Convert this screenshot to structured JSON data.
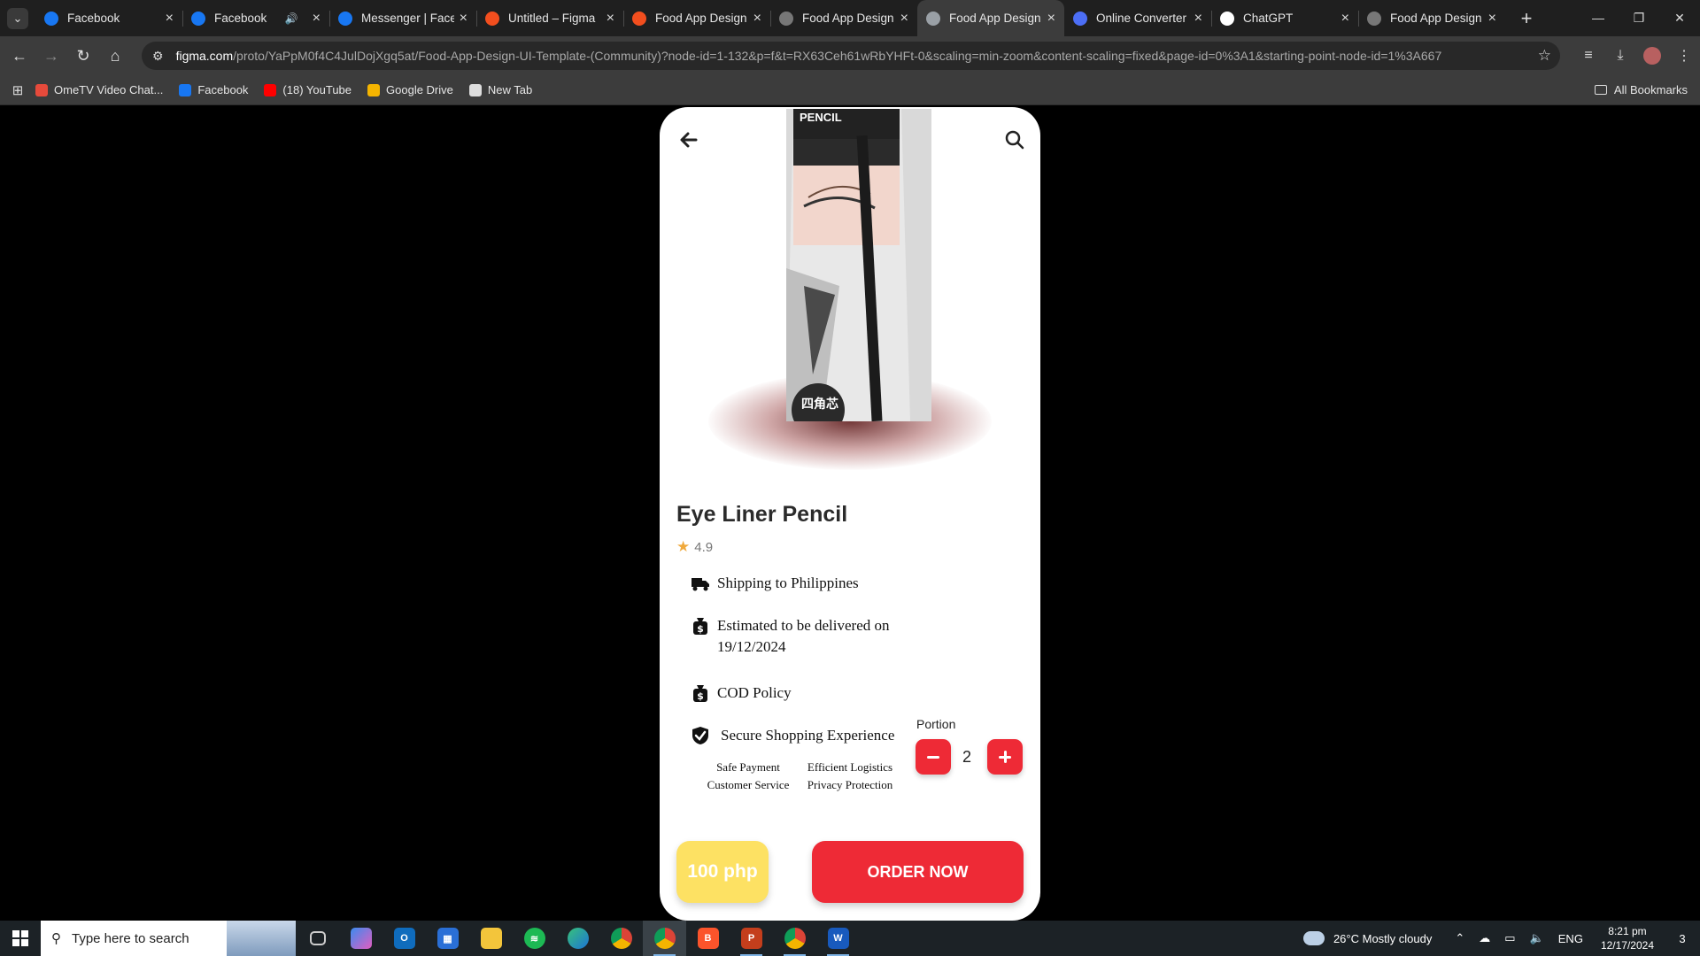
{
  "browser": {
    "tabs": [
      {
        "title": "Facebook",
        "favicon": "facebook-icon",
        "color": "#1877f2"
      },
      {
        "title": "Facebook",
        "favicon": "facebook-icon",
        "color": "#1877f2",
        "audio": true
      },
      {
        "title": "Messenger | Faceb",
        "favicon": "facebook-icon",
        "color": "#1877f2"
      },
      {
        "title": "Untitled – Figma",
        "favicon": "figma-icon",
        "color": "#f24e1e"
      },
      {
        "title": "Food App Design",
        "favicon": "figma-icon",
        "color": "#f24e1e"
      },
      {
        "title": "Food App Design",
        "favicon": "globe-icon",
        "color": "#777777"
      },
      {
        "title": "Food App Design",
        "favicon": "play-icon",
        "color": "#9aa0a6",
        "active": true
      },
      {
        "title": "Online Converter",
        "favicon": "converter-icon",
        "color": "#4c6ef5"
      },
      {
        "title": "ChatGPT",
        "favicon": "chatgpt-icon",
        "color": "#ffffff"
      },
      {
        "title": "Food App Design",
        "favicon": "globe-icon",
        "color": "#777777"
      }
    ],
    "url_host": "figma.com",
    "url_path": "/proto/YaPpM0f4C4JulDojXgq5at/Food-App-Design-UI-Template-(Community)?node-id=1-132&p=f&t=RX63Ceh61wRbYHFt-0&scaling=min-zoom&content-scaling=fixed&page-id=0%3A1&starting-point-node-id=1%3A667",
    "bookmarks": [
      {
        "label": "OmeTV Video Chat...",
        "icon": "ometv-icon",
        "color": "#e64a3b"
      },
      {
        "label": "Facebook",
        "icon": "facebook-icon",
        "color": "#1877f2"
      },
      {
        "label": "(18) YouTube",
        "icon": "youtube-icon",
        "color": "#ff0000"
      },
      {
        "label": "Google Drive",
        "icon": "google-drive-icon",
        "color": "#f4b400"
      },
      {
        "label": "New Tab",
        "icon": "globe-icon",
        "color": "#dddddd"
      }
    ],
    "all_bookmarks": "All Bookmarks"
  },
  "product": {
    "image_label": "PENCIL",
    "image_brand": "EYELINER PENCIL",
    "title": "Eye Liner Pencil",
    "rating": "4.9",
    "shipping": "Shipping to Philippines",
    "estimate": "Estimated to be delivered on 19/12/2024",
    "cod": "COD Policy",
    "secure": "Secure Shopping Experience",
    "features": [
      "Safe Payment",
      "Efficient Logistics",
      "Customer Service",
      "Privacy Protection"
    ],
    "portion_label": "Portion",
    "quantity": "2",
    "price": "100 php",
    "order_label": "ORDER NOW",
    "accent": "#ee2a36",
    "price_color": "#fde163"
  },
  "taskbar": {
    "search_placeholder": "Type here to search",
    "weather": "26°C  Mostly cloudy",
    "lang": "ENG",
    "time": "8:21 pm",
    "date": "12/17/2024",
    "notifications": "3"
  }
}
